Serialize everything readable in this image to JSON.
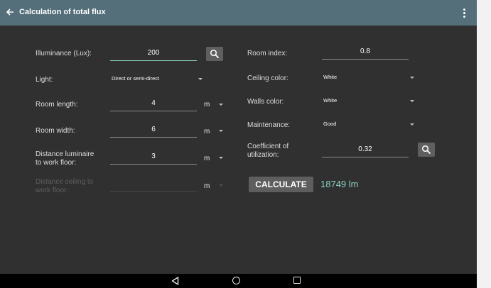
{
  "appbar": {
    "title": "Calculation of total flux",
    "icons": {
      "back": "arrow-back-icon",
      "menu": "more-vert-icon"
    }
  },
  "form_left": {
    "illuminance": {
      "label": "Illuminance (Lux):",
      "value": "200"
    },
    "light": {
      "label": "Light:",
      "value": "Direct or semi-direct"
    },
    "room_length": {
      "label": "Room length:",
      "value": "4",
      "unit": "m"
    },
    "room_width": {
      "label": "Room width:",
      "value": "6",
      "unit": "m"
    },
    "distance_luminaire": {
      "label_line1": "Distance luminaire",
      "label_line2": "to work floor:",
      "value": "3",
      "unit": "m"
    },
    "distance_ceiling": {
      "label_line1": "Distance ceiling to",
      "label_line2": "work floor:",
      "value": "",
      "unit": "m"
    }
  },
  "form_right": {
    "room_index": {
      "label": "Room index:",
      "value": "0.8"
    },
    "ceiling_color": {
      "label": "Ceiling color:",
      "value": "White"
    },
    "walls_color": {
      "label": "Walls color:",
      "value": "White"
    },
    "maintenance": {
      "label": "Maintenance:",
      "value": "Good"
    },
    "coefficient": {
      "label_line1": "Coefficient of",
      "label_line2": "utilization:",
      "value": "0.32"
    }
  },
  "actions": {
    "calculate_label": "CALCULATE"
  },
  "result": {
    "text": "18749 lm"
  },
  "colors": {
    "appbar": "#546e7a",
    "background": "#303030",
    "accent": "#8ad1c2",
    "button": "#5e5e5e"
  }
}
